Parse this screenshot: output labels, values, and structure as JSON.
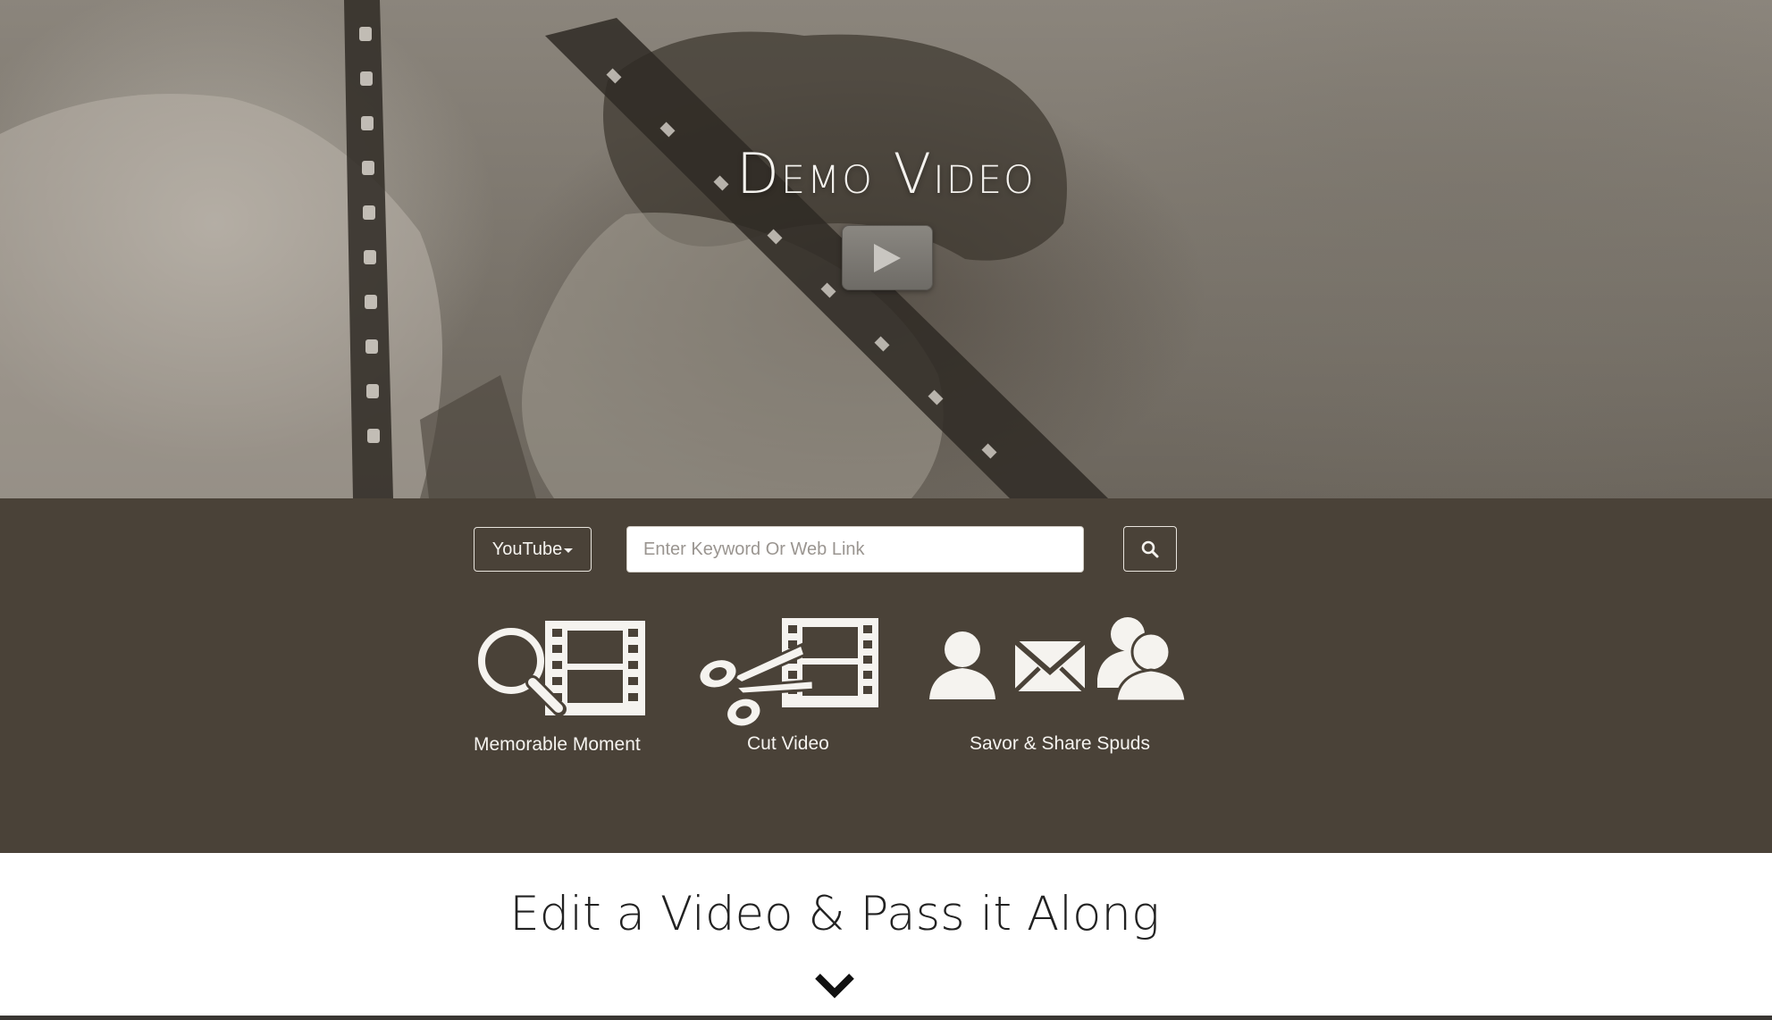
{
  "hero": {
    "title": "Demo Video",
    "play_icon": "play-icon"
  },
  "toolbar": {
    "source_selected": "YouTube",
    "search_placeholder": "Enter Keyword Or Web Link",
    "search_value": "",
    "search_icon": "search-icon"
  },
  "features": [
    {
      "label": "Memorable Moment",
      "icon": "magnifier-film-icon"
    },
    {
      "label": "Cut Video",
      "icon": "scissors-film-icon"
    },
    {
      "label": "Savor & Share Spuds",
      "icon": "share-users-icon"
    }
  ],
  "tagline": {
    "text": "Edit a Video & Pass it Along",
    "scroll_icon": "chevron-down-icon"
  },
  "colors": {
    "panel_bg": "#4a4238",
    "page_bg": "#ffffff",
    "text_light": "#f5f3ef"
  }
}
